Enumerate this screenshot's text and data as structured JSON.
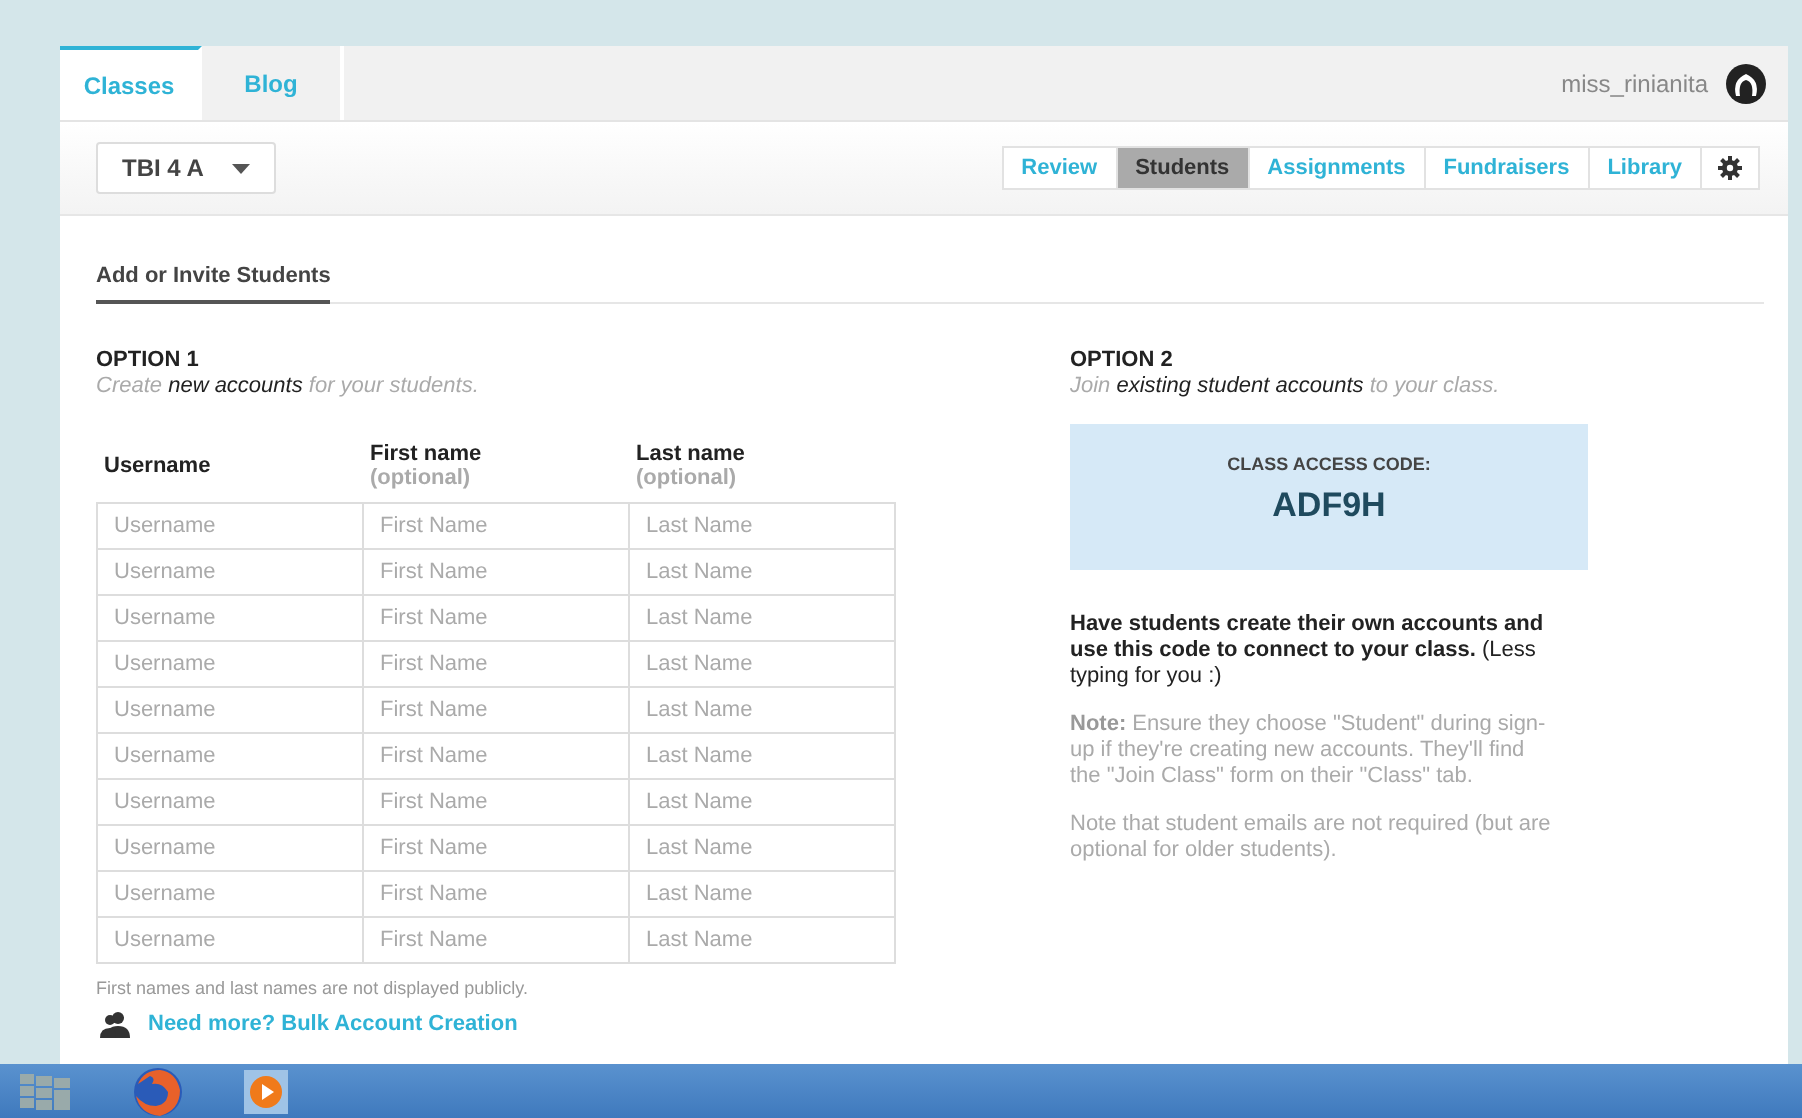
{
  "top_tabs": [
    {
      "label": "Classes",
      "selected": true
    },
    {
      "label": "Blog",
      "selected": false
    }
  ],
  "user": {
    "name": "miss_rinianita"
  },
  "class_select": {
    "value": "TBI 4 A"
  },
  "nav": [
    {
      "label": "Review",
      "selected": false
    },
    {
      "label": "Students",
      "selected": true
    },
    {
      "label": "Assignments",
      "selected": false
    },
    {
      "label": "Fundraisers",
      "selected": false
    },
    {
      "label": "Library",
      "selected": false
    }
  ],
  "section_tab": {
    "label": "Add or Invite Students"
  },
  "option1": {
    "title": "OPTION 1",
    "subtitle": "Create **new accounts** for your students.",
    "columns": [
      {
        "label": "Username"
      },
      {
        "label": "First name",
        "hint": "(optional)"
      },
      {
        "label": "Last name",
        "hint": "(optional)"
      }
    ],
    "rows": [
      [
        {
          "placeholder": "Username"
        },
        {
          "placeholder": "First Name"
        },
        {
          "placeholder": "Last Name"
        }
      ],
      [
        {
          "placeholder": "Username"
        },
        {
          "placeholder": "First Name"
        },
        {
          "placeholder": "Last Name"
        }
      ],
      [
        {
          "placeholder": "Username"
        },
        {
          "placeholder": "First Name"
        },
        {
          "placeholder": "Last Name"
        }
      ],
      [
        {
          "placeholder": "Username"
        },
        {
          "placeholder": "First Name"
        },
        {
          "placeholder": "Last Name"
        }
      ],
      [
        {
          "placeholder": "Username"
        },
        {
          "placeholder": "First Name"
        },
        {
          "placeholder": "Last Name"
        }
      ],
      [
        {
          "placeholder": "Username"
        },
        {
          "placeholder": "First Name"
        },
        {
          "placeholder": "Last Name"
        }
      ],
      [
        {
          "placeholder": "Username"
        },
        {
          "placeholder": "First Name"
        },
        {
          "placeholder": "Last Name"
        }
      ],
      [
        {
          "placeholder": "Username"
        },
        {
          "placeholder": "First Name"
        },
        {
          "placeholder": "Last Name"
        }
      ],
      [
        {
          "placeholder": "Username"
        },
        {
          "placeholder": "First Name"
        },
        {
          "placeholder": "Last Name"
        }
      ],
      [
        {
          "placeholder": "Username"
        },
        {
          "placeholder": "First Name"
        },
        {
          "placeholder": "Last Name"
        }
      ]
    ],
    "footnote": "First names and last names are not displayed publicly.",
    "bulk_link": "Need more? Bulk Account Creation"
  },
  "option2": {
    "title": "OPTION 2",
    "subtitle": "Join **existing student accounts** to your class.",
    "code_label": "CLASS ACCESS CODE:",
    "code": "ADF9H",
    "lead": "**Have students create their own accounts and use this code to connect to your class.** (Less typing for you :)",
    "notes": [
      "**Note:** Ensure they choose \"Student\" during sign-up if they're creating new accounts. They'll find the \"Join Class\" form on their \"Class\" tab.",
      "Note that student emails are not required (but are optional for older students)."
    ]
  },
  "taskbar": [
    {
      "kind": "grid"
    },
    {
      "kind": "browser"
    },
    {
      "kind": "player"
    }
  ]
}
